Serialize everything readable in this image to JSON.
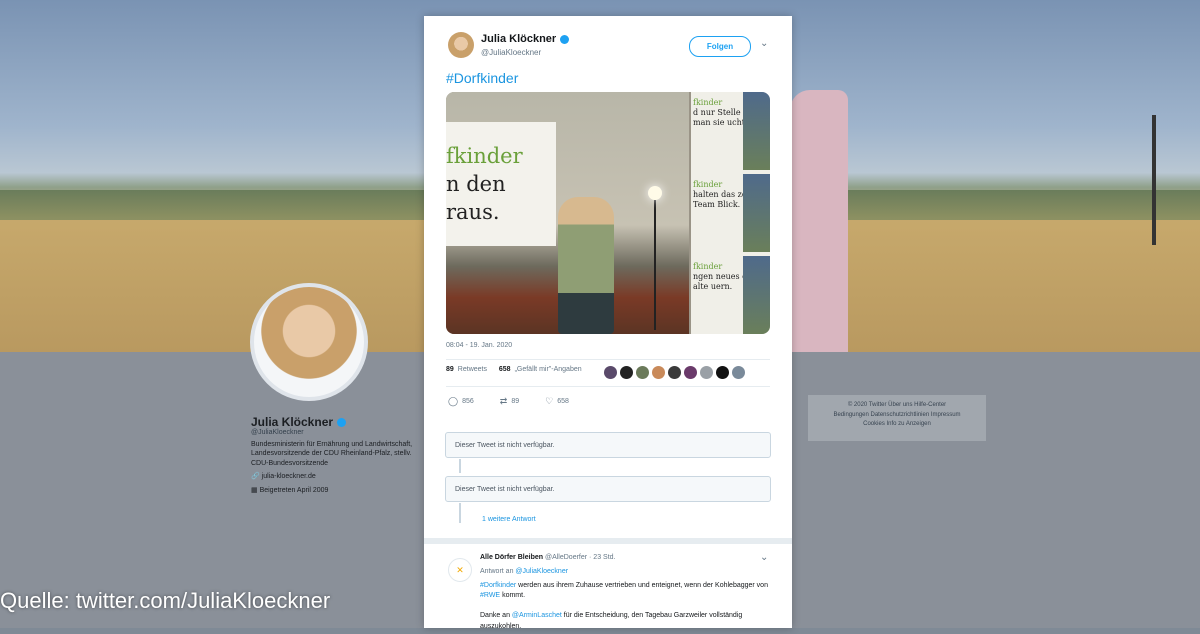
{
  "profile": {
    "name": "Julia Klöckner",
    "handle": "@JuliaKloeckner",
    "bio": "Bundesministerin für Ernährung und Landwirtschaft, Landesvorsitzende der CDU Rheinland-Pfalz, stellv. CDU-Bundesvorsitzende",
    "website": "julia-kloeckner.de",
    "joined": "Beigetreten April 2009"
  },
  "footer": {
    "line1": "© 2020 Twitter   Über uns   Hilfe-Center",
    "line2": "Bedingungen   Datenschutzrichtlinien   Impressum",
    "line3": "Cookies   Info zu Anzeigen"
  },
  "tweet": {
    "author": "Julia Klöckner",
    "handle": "@JuliaKloeckner",
    "follow_label": "Folgen",
    "hashtag": "#Dorfkinder",
    "media": {
      "line1": "fkinder",
      "line2": "n den",
      "line3": "raus.",
      "tile1_green": "fkinder",
      "tile1_text": "d nur Stelle wo man sie ucht.",
      "tile2_green": "fkinder",
      "tile2_text": "halten das ze Team Blick.",
      "tile3_green": "fkinder",
      "tile3_text": "ngen neues en in alte uern."
    },
    "timestamp": "08:04 - 19. Jan. 2020",
    "retweets_count": "89",
    "retweets_label": "Retweets",
    "likes_count": "658",
    "likes_label": "„Gefällt mir\"-Angaben",
    "replies": "856",
    "retweets_action": "89",
    "likes_action": "658"
  },
  "thread": {
    "unavailable1": "Dieser Tweet ist nicht verfügbar.",
    "unavailable2": "Dieser Tweet ist nicht verfügbar.",
    "more_replies": "1 weitere Antwort"
  },
  "reply": {
    "author": "Alle Dörfer Bleiben",
    "handle_time": "@AlleDoerfer · 23 Std.",
    "reply_to_prefix": "Antwort an",
    "reply_to_handle": "@JuliaKloeckner",
    "body_tag": "#Dorfkinder",
    "body_line1": "werden aus ihrem Zuhause vertrieben und enteignet, wenn der Kohlebagger von",
    "body_rwe": "#RWE",
    "body_line1_end": "kommt.",
    "body2_prefix": "Danke an",
    "body2_handle": "@ArminLaschet",
    "body2_text": "für die Entscheidung, den Tagebau Garzweiler vollständig auszukohlen."
  },
  "caption": "Quelle: twitter.com/JuliaKloeckner",
  "colors": {
    "accent": "#1da1f2",
    "link": "#1b95e0",
    "green_text": "#6aa03a"
  }
}
